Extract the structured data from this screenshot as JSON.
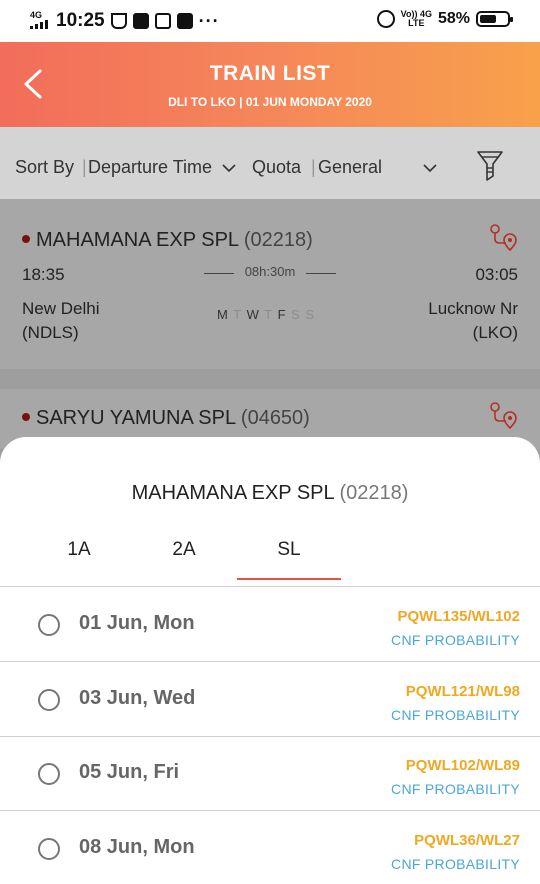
{
  "status_bar": {
    "network_left": "4G",
    "time": "10:25",
    "more": "···",
    "volte": "Vo)) 4G",
    "volte_sub": "LTE",
    "battery": "58%"
  },
  "header": {
    "title": "TRAIN LIST",
    "subtitle": "DLI TO LKO | 01 JUN MONDAY 2020"
  },
  "sort_bar": {
    "sort_label": "Sort By",
    "sort_value": "Departure Time",
    "quota_label": "Quota",
    "quota_value": "General"
  },
  "trains": [
    {
      "name": "MAHAMANA EXP SPL",
      "number": "(02218)",
      "dep_time": "18:35",
      "arr_time": "03:05",
      "duration": "08h:30m",
      "from_name": "New Delhi",
      "from_code": "(NDLS)",
      "to_name": "Lucknow Nr",
      "to_code": "(LKO)",
      "days": [
        "M",
        "T",
        "W",
        "T",
        "F",
        "S",
        "S"
      ]
    },
    {
      "name": "SARYU YAMUNA SPL",
      "number": "(04650)"
    }
  ],
  "sheet": {
    "train_name": "MAHAMANA EXP SPL",
    "train_number": "(02218)",
    "tabs": [
      "1A",
      "2A",
      "SL"
    ],
    "active_tab": "SL",
    "rows": [
      {
        "date": "01 Jun, Mon",
        "status": "PQWL135/WL102",
        "prob": "CNF PROBABILITY"
      },
      {
        "date": "03 Jun, Wed",
        "status": "PQWL121/WL98",
        "prob": "CNF PROBABILITY"
      },
      {
        "date": "05 Jun, Fri",
        "status": "PQWL102/WL89",
        "prob": "CNF PROBABILITY"
      },
      {
        "date": "08 Jun, Mon",
        "status": "PQWL36/WL27",
        "prob": "CNF PROBABILITY"
      }
    ]
  },
  "colors": {
    "header_start": "#f26d5a",
    "header_end": "#f8a14b",
    "accent": "#e8553f",
    "waitlist": "#f0a822",
    "probability": "#4aa7d8"
  }
}
